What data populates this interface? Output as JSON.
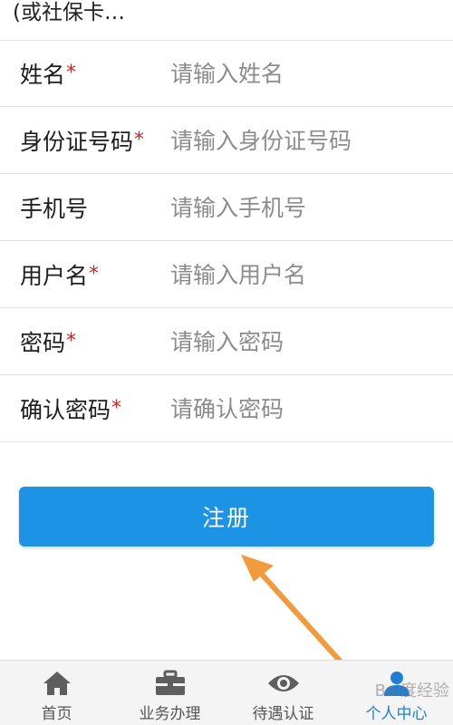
{
  "top_row": {
    "label": "(或社保卡…"
  },
  "form": {
    "rows": [
      {
        "label": "姓名",
        "required": "*",
        "placeholder": "请输入姓名"
      },
      {
        "label": "身份证号码",
        "required": "*",
        "placeholder": "请输入身份证号码"
      },
      {
        "label": "手机号",
        "required": "",
        "placeholder": "请输入手机号"
      },
      {
        "label": "用户名",
        "required": "*",
        "placeholder": "请输入用户名"
      },
      {
        "label": "密码",
        "required": "*",
        "placeholder": "请输入密码"
      },
      {
        "label": "确认密码",
        "required": "*",
        "placeholder": "请确认密码"
      }
    ]
  },
  "register_label": "注册",
  "nav": {
    "items": [
      {
        "label": "首页",
        "icon": "home-icon"
      },
      {
        "label": "业务办理",
        "icon": "briefcase-icon"
      },
      {
        "label": "待遇认证",
        "icon": "eye-icon"
      },
      {
        "label": "个人中心",
        "icon": "user-icon",
        "active": true
      }
    ]
  },
  "watermark": "Bai度经验",
  "colors": {
    "accent": "#1d93e6",
    "required_star": "#c62828",
    "annotation_arrow": "#f39a3c",
    "active_nav": "#1d7fd6"
  }
}
